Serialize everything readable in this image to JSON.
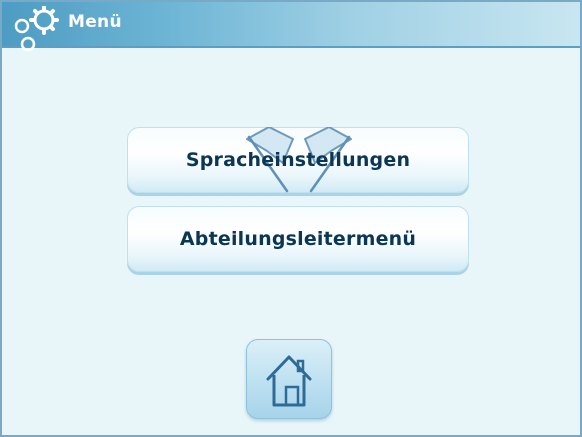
{
  "header": {
    "title": "Menü",
    "icon": "gears-icon"
  },
  "menu": {
    "items": [
      {
        "label": "Spracheinstellungen",
        "icon": "flags-icon"
      },
      {
        "label": "Abteilungsleitermenü"
      }
    ]
  },
  "home": {
    "icon": "home-icon"
  },
  "colors": {
    "header_gradient_start": "#4d9cc3",
    "header_gradient_end": "#c8e6f1",
    "background": "#e8f6fa",
    "button_text": "#0b3754",
    "home_button": "#bfe2f1"
  }
}
